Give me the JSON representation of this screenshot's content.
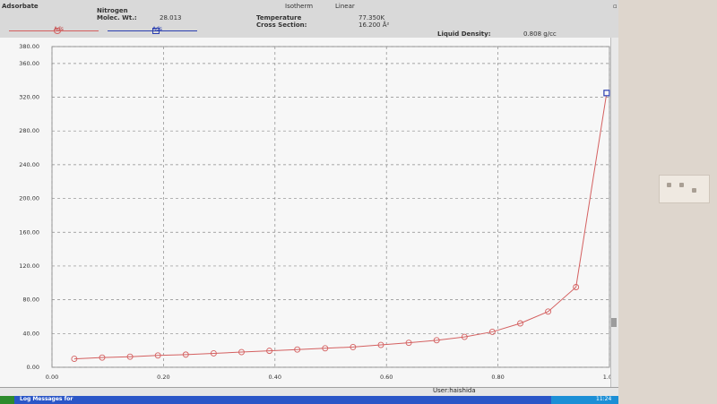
{
  "header": {
    "adsorbate_label": "Adsorbate",
    "gas_name": "Nitrogen",
    "molec_wt_label": "Molec. Wt.:",
    "molec_wt_value": "28.013",
    "isotherm_label": "Isotherm",
    "linear_label": "Linear",
    "temperature_label": "Temperature",
    "temperature_value": "77.350K",
    "cross_section_label": "Cross Section:",
    "cross_section_value": "16.200 Å²",
    "liquid_density_label": "Liquid Density:",
    "liquid_density_value": "0.808 g/cc",
    "legend_ads_label": "Ads",
    "legend_des_label": "Ads"
  },
  "colors": {
    "adsorption": "#d46060",
    "desorption": "#2b3fb0",
    "grid": "#8a8a8a"
  },
  "status": {
    "user": "User:haishida"
  },
  "taskbar": {
    "title": "Log Messages for",
    "clock": "11:24"
  },
  "chart_data": {
    "type": "line",
    "x_ticks": [
      "0.00",
      "0.20",
      "0.40",
      "0.60",
      "0.80",
      "1.00"
    ],
    "y_ticks": [
      "0.00",
      "40.00",
      "80.00",
      "120.00",
      "160.00",
      "200.00",
      "240.00",
      "280.00",
      "320.00",
      "360.00",
      "380.00"
    ],
    "xlim": [
      0,
      1
    ],
    "ylim": [
      0,
      380
    ],
    "grid": true,
    "series": [
      {
        "name": "Ads",
        "marker": "circle",
        "x": [
          0.04,
          0.09,
          0.14,
          0.19,
          0.24,
          0.29,
          0.34,
          0.39,
          0.44,
          0.49,
          0.54,
          0.59,
          0.64,
          0.69,
          0.74,
          0.79,
          0.84,
          0.89,
          0.94,
          0.995
        ],
        "y": [
          10,
          11.5,
          12.5,
          14,
          15,
          16.5,
          18,
          19.5,
          21,
          22.5,
          24,
          26.5,
          29,
          32,
          36,
          42,
          52,
          66,
          95,
          325
        ]
      },
      {
        "name": "Ads",
        "marker": "square",
        "x": [
          0.995
        ],
        "y": [
          325
        ]
      }
    ]
  }
}
